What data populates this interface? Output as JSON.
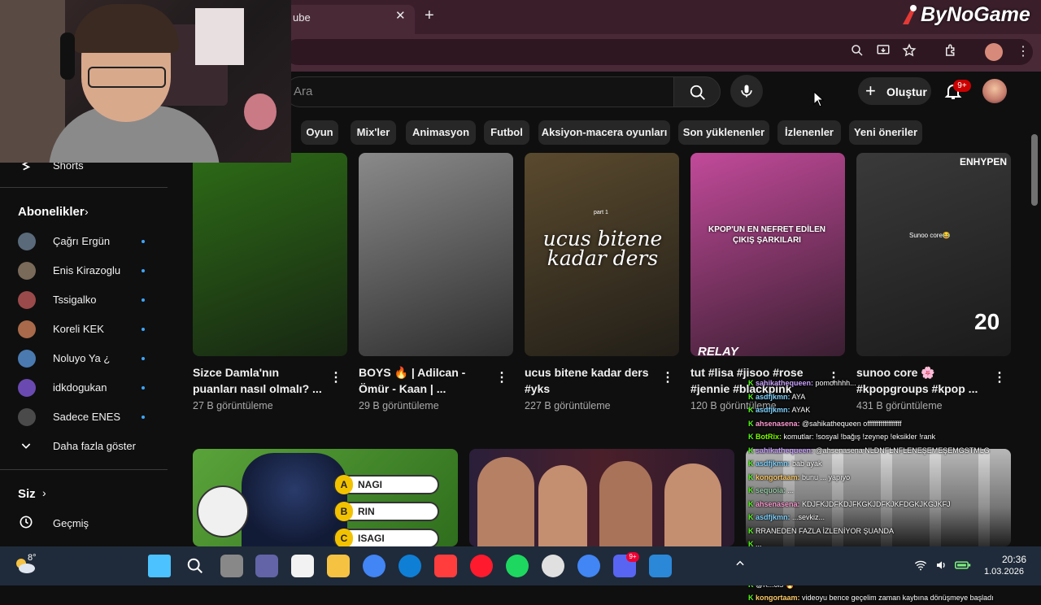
{
  "browser": {
    "tab_title": "ube",
    "tab_close": "✕",
    "new_tab": "+"
  },
  "brand": {
    "name": "ByNoGame"
  },
  "header": {
    "search_placeholder": "Ara",
    "create_label": "Oluştur",
    "notification_count": "9+"
  },
  "chips": [
    "Oyun",
    "Mix'ler",
    "Animasyon",
    "Futbol",
    "Aksiyon-macera oyunları",
    "Son yüklenenler",
    "İzlenenler",
    "Yeni öneriler"
  ],
  "sidebar": {
    "shorts_label": "Shorts",
    "subscriptions_heading": "Abonelikler",
    "subscriptions": [
      "Çağrı Ergün",
      "Enis Kirazoglu",
      "Tssigalko",
      "Koreli KEK",
      "Noluyo Ya ¿",
      "idkdogukan",
      "Sadece ENES"
    ],
    "show_more": "Daha fazla göster",
    "you_heading": "Siz",
    "history_label": "Geçmiş"
  },
  "videos": [
    {
      "title": "Sizce Damla'nın puanları nasıl olmalı? ...",
      "views": "27 B görüntüleme",
      "thumb_color": "#2d6b17"
    },
    {
      "title": "BOYS 🔥 | Adilcan - Ömür - Kaan | ...",
      "views": "29 B görüntüleme",
      "thumb_color": "#8a8a8a"
    },
    {
      "title": "ucus bitene kadar ders #yks",
      "views": "227 B görüntüleme",
      "thumb_color": "#5a4a2e",
      "thumb_text": "ucus bitene kadar ders",
      "thumb_subtext": "part 1"
    },
    {
      "title": "tut #lisa #jisoo #rose #jennie #blackpink",
      "views": "120 B görüntüleme",
      "thumb_color": "#c24a9a",
      "thumb_text": "KPOP'UN EN NEFRET EDİLEN ÇIKIŞ ŞARKILARI",
      "thumb_footer": "RELAY"
    },
    {
      "title": "sunoo core 🌸 #kpopgroups #kpop ...",
      "views": "431 B görüntüleme",
      "thumb_color": "#3a3a3a",
      "thumb_text": "ENHYPEN",
      "thumb_subtext": "Sunoo core😂",
      "thumb_number": "20"
    }
  ],
  "bottom_thumbs": {
    "quiz_options": [
      {
        "letter": "A",
        "text": "NAGI"
      },
      {
        "letter": "B",
        "text": "RIN"
      },
      {
        "letter": "C",
        "text": "ISAGI"
      }
    ]
  },
  "chat": [
    {
      "user": "sahikathequeen:",
      "msg": "pomohhhh...",
      "color": "#c9a0ff"
    },
    {
      "user": "asdfjkmn:",
      "msg": "AYA",
      "color": "#7fd3ff"
    },
    {
      "user": "asdfjkmn:",
      "msg": "AYAK",
      "color": "#7fd3ff"
    },
    {
      "user": "ahsenasena:",
      "msg": "@sahikathequeen offffffffffffffffff",
      "color": "#ff9bd2"
    },
    {
      "user": "BotRix:",
      "msg": "komutlar: !sosyal !bağış !zeynep !eksikler !rank",
      "color": "#7CFC00"
    },
    {
      "user": "sahikathequeen:",
      "msg": "@ahsenasena NLDNFLNFLENEŞEMEŞEMGSTMLG",
      "color": "#c9a0ff"
    },
    {
      "user": "asdfjkmn:",
      "msg": "bab ayak",
      "color": "#7fd3ff"
    },
    {
      "user": "kongortaam:",
      "msg": "bunu ... yapıyo",
      "color": "#ffcc66"
    },
    {
      "user": "sequoia:",
      "msg": "...",
      "color": "#9ad1a9"
    },
    {
      "user": "ahsenasena:",
      "msg": "KDJFKJDFKDJFKGKJDFKJKFDGKJKGJKFJ",
      "color": "#ff9bd2"
    },
    {
      "user": "asdfjkmn:",
      "msg": "...sevkiz...",
      "color": "#7fd3ff"
    },
    {
      "user": "",
      "msg": "RRANEDEN FAZLA İZLENİYOR ŞUANDA",
      "color": "#ffffff"
    },
    {
      "user": "",
      "msg": "...",
      "color": "#ffffff"
    },
    {
      "user": "",
      "msg": "...",
      "color": "#ffffff"
    },
    {
      "user": "ahsenasena:",
      "msg": "asırı tetiklendim aq ben,m is yeri mi bu",
      "color": "#ff9bd2"
    },
    {
      "user": "",
      "msg": "@K...ols 🔥",
      "color": "#ffffff"
    },
    {
      "user": "kongortaam:",
      "msg": "videoyu bence geçelim zaman kaybına dönüşmeye başladı",
      "color": "#ffcc66"
    }
  ],
  "taskbar": {
    "weather_temp": "8°",
    "time": "20:36",
    "date": "1.03.2026",
    "discord_badge": "9+",
    "icons": [
      "windows-start-icon",
      "search-icon",
      "task-view-icon",
      "teams-icon",
      "store-icon",
      "file-explorer-icon",
      "chrome-icon",
      "edge-icon",
      "youtube-music-icon",
      "opera-icon",
      "spotify-icon",
      "obs-icon",
      "chrome-profile-icon",
      "discord-icon",
      "remote-desktop-icon"
    ]
  }
}
